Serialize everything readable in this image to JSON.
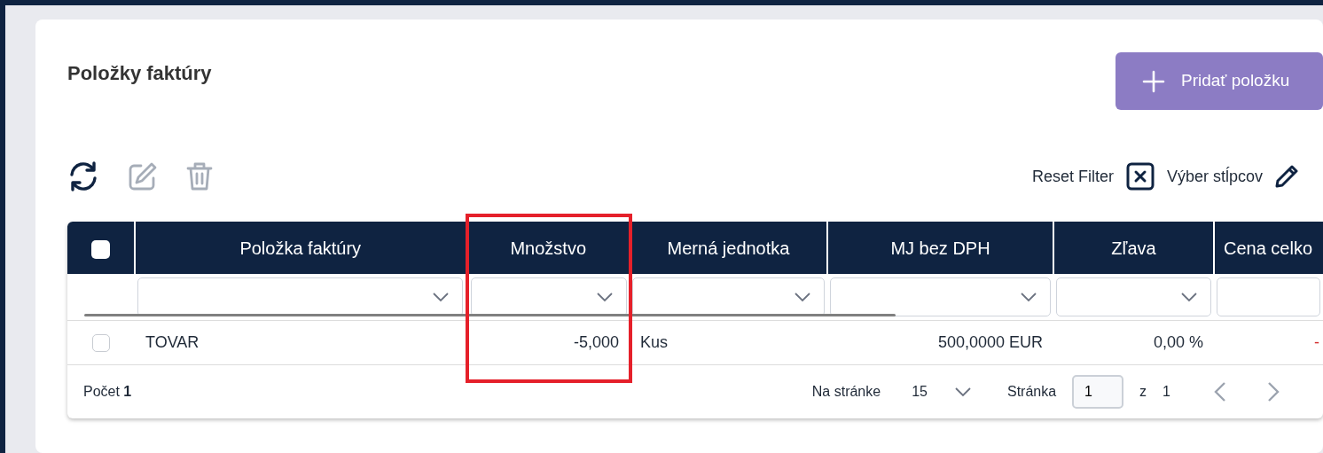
{
  "card": {
    "title": "Položky faktúry",
    "add_button": {
      "label": "Pridať položku"
    }
  },
  "toolbar": {
    "actions": [
      {
        "kind": "refresh",
        "disabled": false
      },
      {
        "kind": "edit",
        "disabled": true
      },
      {
        "kind": "delete",
        "disabled": true
      }
    ],
    "reset_filter": {
      "label": "Reset Filter"
    },
    "column_picker": {
      "label": "Výber stĺpcov"
    }
  },
  "table": {
    "select_all": {
      "checked": false
    },
    "columns": [
      {
        "label": "Položka faktúry",
        "kind": "text",
        "highlighted": false
      },
      {
        "label": "Množstvo",
        "kind": "number",
        "highlighted": true
      },
      {
        "label": "Merná jednotka",
        "kind": "text",
        "highlighted": false
      },
      {
        "label": "MJ bez DPH",
        "kind": "number",
        "highlighted": false
      },
      {
        "label": "Zľava",
        "kind": "number",
        "highlighted": false
      },
      {
        "label": "Cena celko",
        "kind": "number",
        "highlighted": false
      }
    ],
    "rows": [
      {
        "selected": false,
        "cells": [
          {
            "text": "TOVAR"
          },
          {
            "text": "-5,000"
          },
          {
            "text": "Kus"
          },
          {
            "text": "500,0000 EUR"
          },
          {
            "text": "0,00 %"
          },
          {
            "text": "-",
            "color": "#d32f2f"
          }
        ]
      }
    ]
  },
  "footer": {
    "count": "Počet **1**",
    "per_page_label": "Na stránke",
    "per_page": "15",
    "page_label": "Stránka",
    "page": "1",
    "of_label": "z",
    "pages": "1"
  }
}
